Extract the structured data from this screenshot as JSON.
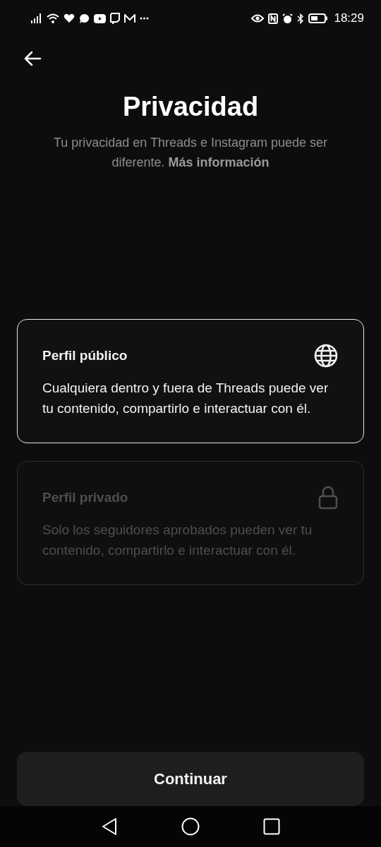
{
  "status_bar": {
    "time": "18:29"
  },
  "header": {
    "title": "Privacidad",
    "subtitle": "Tu privacidad en Threads e Instagram puede ser diferente.",
    "subtitle_link": "Más información"
  },
  "options": [
    {
      "kind": "globe",
      "title": "Perfil público",
      "description": "Cualquiera dentro y fuera de Threads puede ver tu contenido, compartirlo e interactuar con él.",
      "selected": true
    },
    {
      "kind": "lock",
      "title": "Perfil privado",
      "description": "Solo los seguidores aprobados pueden ver tu contenido, compartirlo e interactuar con él.",
      "selected": false
    }
  ],
  "primary_button": {
    "label": "Continuar"
  }
}
